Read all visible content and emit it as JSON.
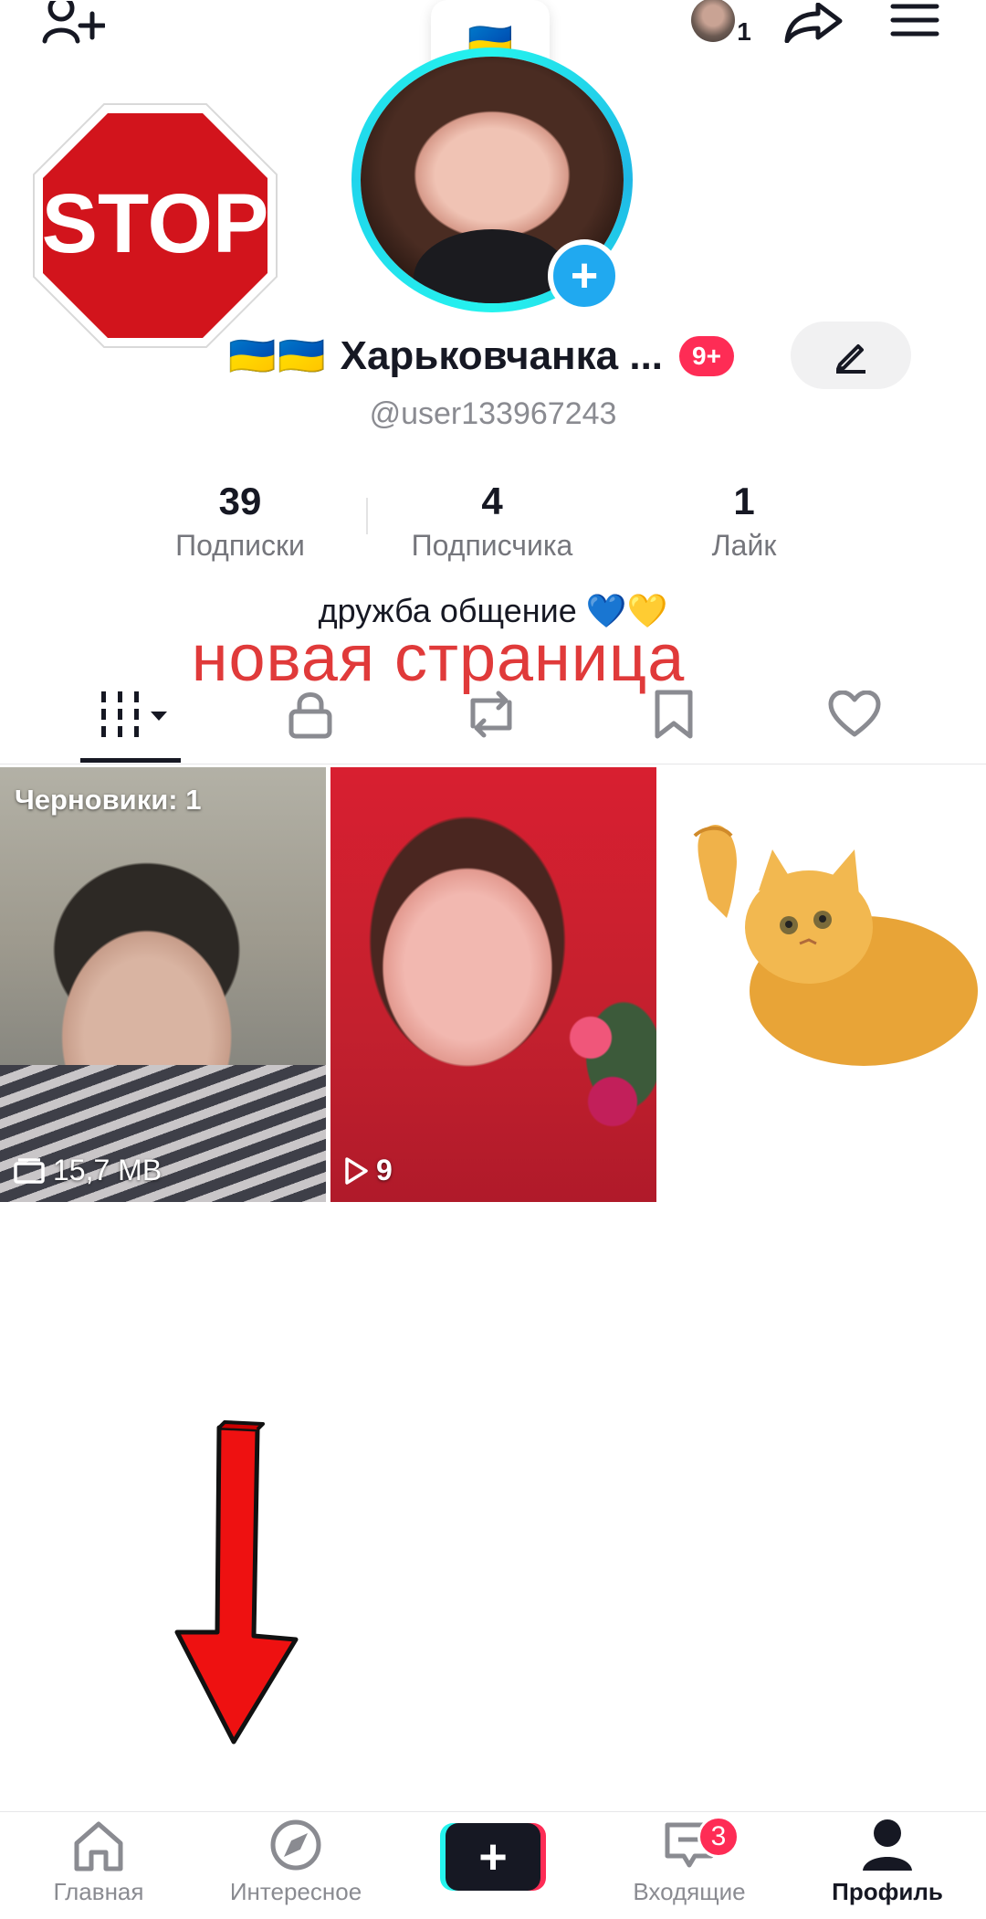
{
  "topbar": {
    "story_emoji": "🇺🇦",
    "visitors_count": "1"
  },
  "stop_sign": {
    "text": "STOP"
  },
  "profile": {
    "flags": "🇺🇦🇺🇦",
    "display_name": "Харьковчанка ...",
    "notifications_badge": "9+",
    "username": "@user133967243",
    "bio": "дружба общение 💙💛",
    "overlay_text": "новая страница"
  },
  "stats": [
    {
      "value": "39",
      "label": "Подписки"
    },
    {
      "value": "4",
      "label": "Подписчика"
    },
    {
      "value": "1",
      "label": "Лайк"
    }
  ],
  "tabs": [
    {
      "icon": "grid-icon",
      "active": true
    },
    {
      "icon": "lock-icon"
    },
    {
      "icon": "repost-icon"
    },
    {
      "icon": "bookmark-icon"
    },
    {
      "icon": "heart-icon"
    }
  ],
  "grid": {
    "drafts_label": "Черновики: 1",
    "drafts_size": "15,7 MB",
    "video_views": "9"
  },
  "bottom_nav": {
    "items": [
      {
        "label": "Главная",
        "icon": "home-icon"
      },
      {
        "label": "Интересное",
        "icon": "compass-icon"
      },
      {
        "label": "",
        "icon": "plus-icon"
      },
      {
        "label": "Входящие",
        "icon": "inbox-icon",
        "badge": "3"
      },
      {
        "label": "Профиль",
        "icon": "profile-icon",
        "active": true
      }
    ]
  },
  "colors": {
    "accent_red": "#fe2c55",
    "accent_cyan": "#25f4ee",
    "text_dark": "#161823",
    "text_gray": "#8a8b91",
    "overlay_red": "#e03a3a"
  }
}
